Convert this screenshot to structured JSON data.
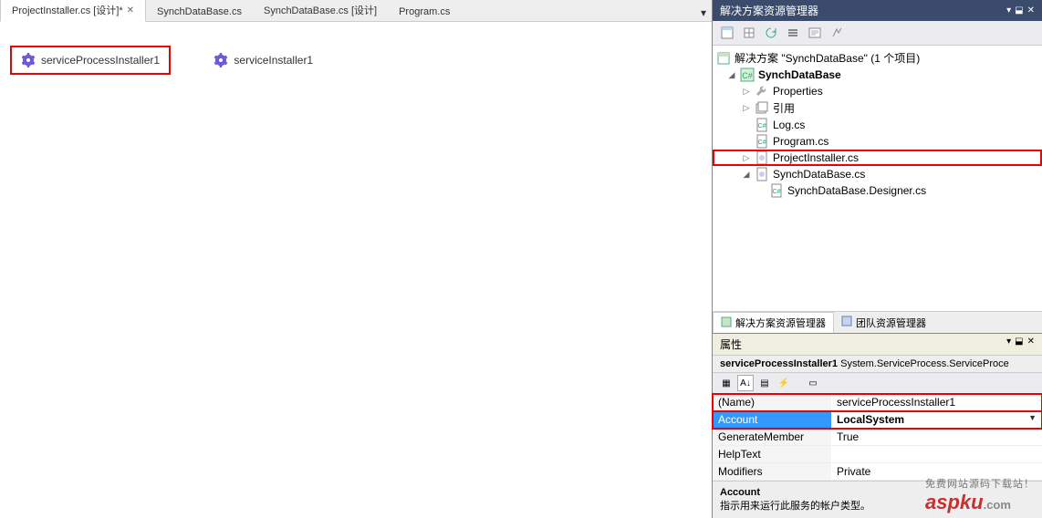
{
  "tabs": [
    {
      "label": "ProjectInstaller.cs [设计]*",
      "active": true
    },
    {
      "label": "SynchDataBase.cs",
      "active": false
    },
    {
      "label": "SynchDataBase.cs [设计]",
      "active": false
    },
    {
      "label": "Program.cs",
      "active": false
    }
  ],
  "designer": {
    "components": [
      {
        "name": "serviceProcessInstaller1",
        "selected": true
      },
      {
        "name": "serviceInstaller1",
        "selected": false
      }
    ]
  },
  "solutionExplorer": {
    "title": "解决方案资源管理器",
    "root": "解决方案 \"SynchDataBase\" (1 个项目)",
    "project": "SynchDataBase",
    "nodes": {
      "properties": "Properties",
      "references": "引用",
      "log": "Log.cs",
      "program": "Program.cs",
      "projectInstaller": "ProjectInstaller.cs",
      "synchDataBase": "SynchDataBase.cs",
      "designer": "SynchDataBase.Designer.cs"
    },
    "bottomTabs": {
      "solution": "解决方案资源管理器",
      "team": "团队资源管理器"
    }
  },
  "properties": {
    "title": "属性",
    "objectName": "serviceProcessInstaller1",
    "objectType": "System.ServiceProcess.ServiceProce",
    "rows": [
      {
        "name": "(Name)",
        "value": "serviceProcessInstaller1"
      },
      {
        "name": "Account",
        "value": "LocalSystem",
        "selected": true,
        "dropdown": true
      },
      {
        "name": "GenerateMember",
        "value": "True"
      },
      {
        "name": "HelpText",
        "value": ""
      },
      {
        "name": "Modifiers",
        "value": "Private"
      }
    ],
    "descTitle": "Account",
    "descText": "指示用来运行此服务的帐户类型。"
  },
  "watermark": {
    "brand": "aspku",
    "dotcom": ".com",
    "sub": "免费网站源码下载站！"
  }
}
